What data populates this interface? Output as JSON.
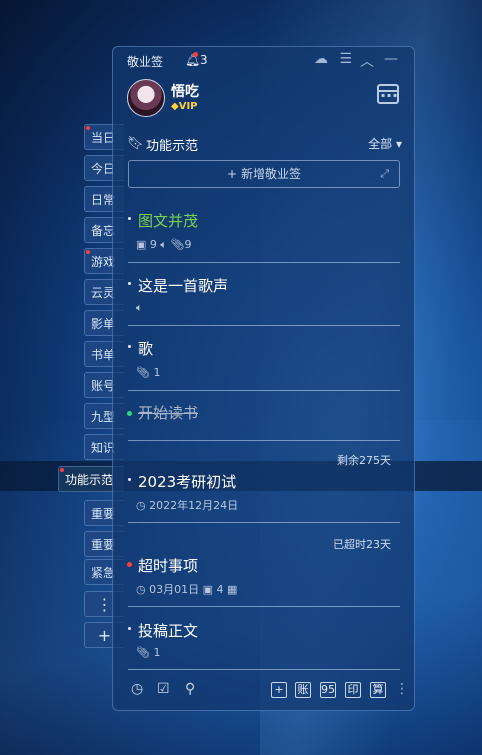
{
  "window": {
    "app_title": "敬业签",
    "notification_count": "3"
  },
  "user": {
    "name": "悟吃",
    "vip": "VIP"
  },
  "section": {
    "name": "功能示范",
    "filter": "全部",
    "new_note": "新增敬业签"
  },
  "side_tabs": [
    {
      "label": "当日",
      "dot": true
    },
    {
      "label": "今日",
      "dot": false
    },
    {
      "label": "日常",
      "dot": false
    },
    {
      "label": "备忘",
      "dot": false
    },
    {
      "label": "游戏",
      "dot": true
    },
    {
      "label": "云灵",
      "dot": false
    },
    {
      "label": "影单",
      "dot": false
    },
    {
      "label": "书单",
      "dot": false
    },
    {
      "label": "账号",
      "dot": false
    },
    {
      "label": "九型",
      "dot": false
    },
    {
      "label": "知识",
      "dot": false
    },
    {
      "label": "功能示范",
      "dot": true,
      "active": true
    },
    {
      "label": "重要",
      "dot": false
    },
    {
      "label": "重要",
      "dot": false
    },
    {
      "label": "紧急",
      "dot": false
    }
  ],
  "notes": [
    {
      "title": "图文并茂",
      "color": "#7ad14e",
      "images": "9",
      "attachments": "9"
    },
    {
      "title": "这是一首歌声"
    },
    {
      "title": "歌",
      "attachments": "1"
    },
    {
      "title": "开始读书",
      "status": "done"
    },
    {
      "badge": "剩余275天",
      "title": "2023考研初试",
      "date": "2022年12月24日"
    },
    {
      "badge": "已超时23天",
      "title": "超时事项",
      "date": "03月01日",
      "images": "4"
    },
    {
      "title": "投稿正文",
      "attachments": "1"
    }
  ],
  "toolbar": {
    "zhang": "账",
    "ninefive": "95",
    "yin": "印",
    "suan": "算"
  }
}
